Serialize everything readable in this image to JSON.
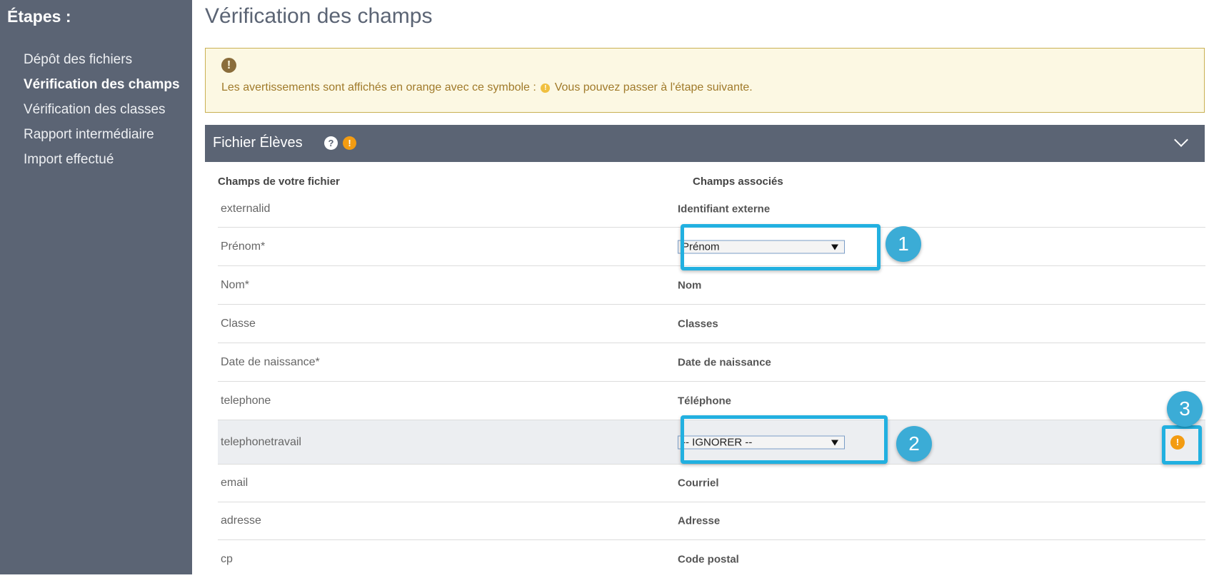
{
  "sidebar": {
    "title": "Étapes :",
    "items": [
      {
        "label": "Dépôt des fichiers",
        "active": false
      },
      {
        "label": "Vérification des champs",
        "active": true
      },
      {
        "label": "Vérification des classes",
        "active": false
      },
      {
        "label": "Rapport intermédiaire",
        "active": false
      },
      {
        "label": "Import effectué",
        "active": false
      }
    ]
  },
  "main": {
    "title": "Vérification des champs",
    "alert": {
      "text_before": "Les avertissements sont affichés en orange avec ce symbole :",
      "text_after": "Vous pouvez passer à l'étape suivante.",
      "icon": "warning-icon"
    },
    "panel": {
      "title": "Fichier Élèves",
      "help_icon": "question-icon",
      "warn_icon": "warning-icon",
      "collapse_icon": "chevron-down-icon",
      "columns": {
        "source": "Champs de votre fichier",
        "target": "Champs associés"
      },
      "rows": [
        {
          "source": "externalid",
          "target": "Identifiant externe"
        },
        {
          "source": "Prénom*",
          "select": "Prénom"
        },
        {
          "source": "Nom*",
          "target": "Nom"
        },
        {
          "source": "Classe",
          "target": "Classes"
        },
        {
          "source": "Date de naissance*",
          "target": "Date de naissance"
        },
        {
          "source": "telephone",
          "target": "Téléphone"
        },
        {
          "source": "telephonetravail",
          "select": "-- IGNORER --",
          "warning": true
        },
        {
          "source": "email",
          "target": "Courriel"
        },
        {
          "source": "adresse",
          "target": "Adresse"
        },
        {
          "source": "cp",
          "target": "Code postal"
        }
      ]
    }
  },
  "callouts": {
    "one": "1",
    "two": "2",
    "three": "3"
  },
  "colors": {
    "sidebar": "#5b6474",
    "callout": "#22b0e0",
    "warning": "#f39c12",
    "alert_bg": "#fcf8e3"
  }
}
